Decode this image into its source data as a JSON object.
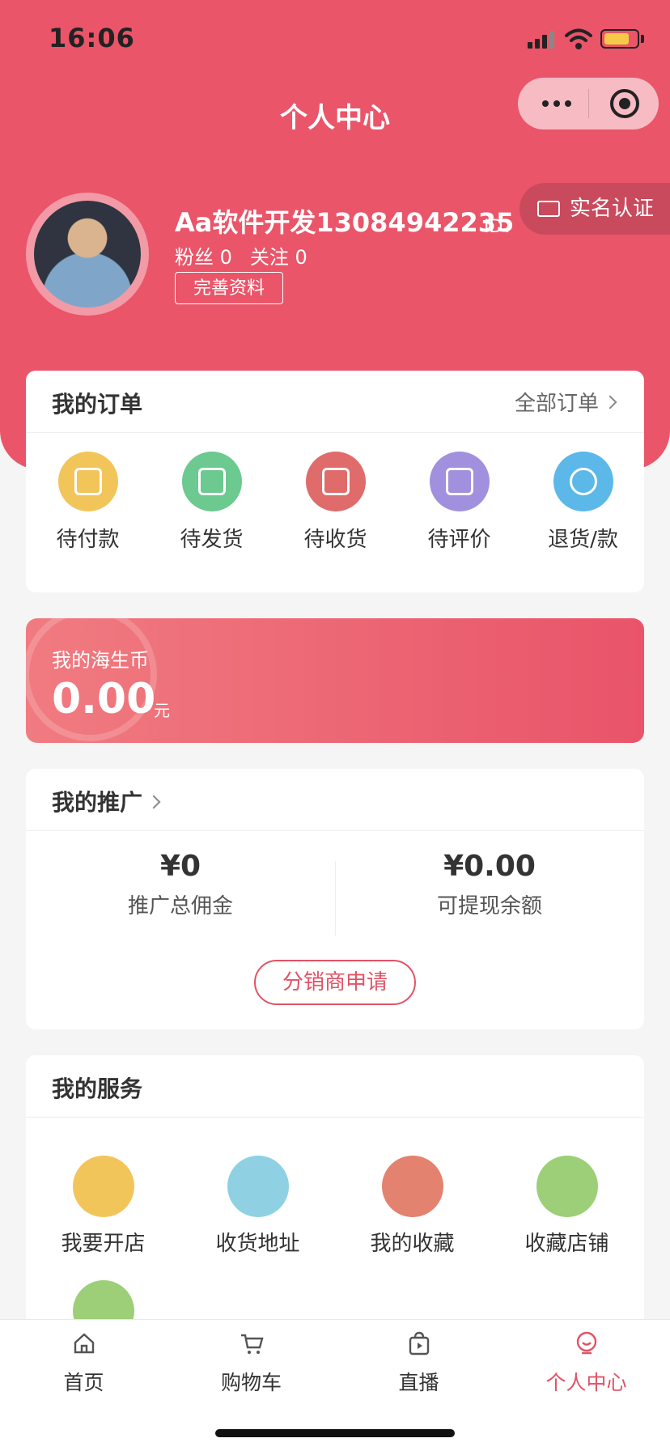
{
  "status_bar": {
    "time": "16:06"
  },
  "nav": {
    "title": "个人中心"
  },
  "profile": {
    "username": "Aa软件开发13084942235",
    "id_label": "ID：",
    "fans": "粉丝 0",
    "follow": "关注 0",
    "edit_label": "完善资料",
    "verify_label": "实名认证"
  },
  "orders": {
    "title": "我的订单",
    "all_label": "全部订单",
    "items": [
      {
        "label": "待付款",
        "icon": "wallet-icon",
        "color": "#f2c55a"
      },
      {
        "label": "待发货",
        "icon": "box-icon",
        "color": "#6cc98f"
      },
      {
        "label": "待收货",
        "icon": "truck-icon",
        "color": "#e06b6b"
      },
      {
        "label": "待评价",
        "icon": "comment-icon",
        "color": "#a190dd"
      },
      {
        "label": "退货/款",
        "icon": "refund-icon",
        "color": "#5bb8e8"
      }
    ]
  },
  "coin": {
    "title": "我的海生币",
    "value": "0.00",
    "unit": "元"
  },
  "promotion": {
    "title": "我的推广",
    "commission_value": "¥0",
    "commission_label": "推广总佣金",
    "withdraw_value": "¥0.00",
    "withdraw_label": "可提现余额",
    "apply_label": "分销商申请"
  },
  "services": {
    "title": "我的服务",
    "items": [
      {
        "label": "我要开店",
        "icon": "store-icon",
        "color": "#f2c55a"
      },
      {
        "label": "收货地址",
        "icon": "location-icon",
        "color": "#8fd1e3"
      },
      {
        "label": "我的收藏",
        "icon": "star-icon",
        "color": "#e3826f"
      },
      {
        "label": "收藏店铺",
        "icon": "shop-icon",
        "color": "#9ccf78"
      },
      {
        "label": "",
        "icon": "customer-service-icon",
        "color": "#9ccf78"
      }
    ]
  },
  "tabbar": {
    "items": [
      {
        "label": "首页",
        "icon": "home-icon"
      },
      {
        "label": "购物车",
        "icon": "cart-icon"
      },
      {
        "label": "直播",
        "icon": "live-icon"
      },
      {
        "label": "个人中心",
        "icon": "profile-icon"
      }
    ],
    "active_color": "#e25265"
  },
  "colors": {
    "brand": "#ea5569"
  }
}
